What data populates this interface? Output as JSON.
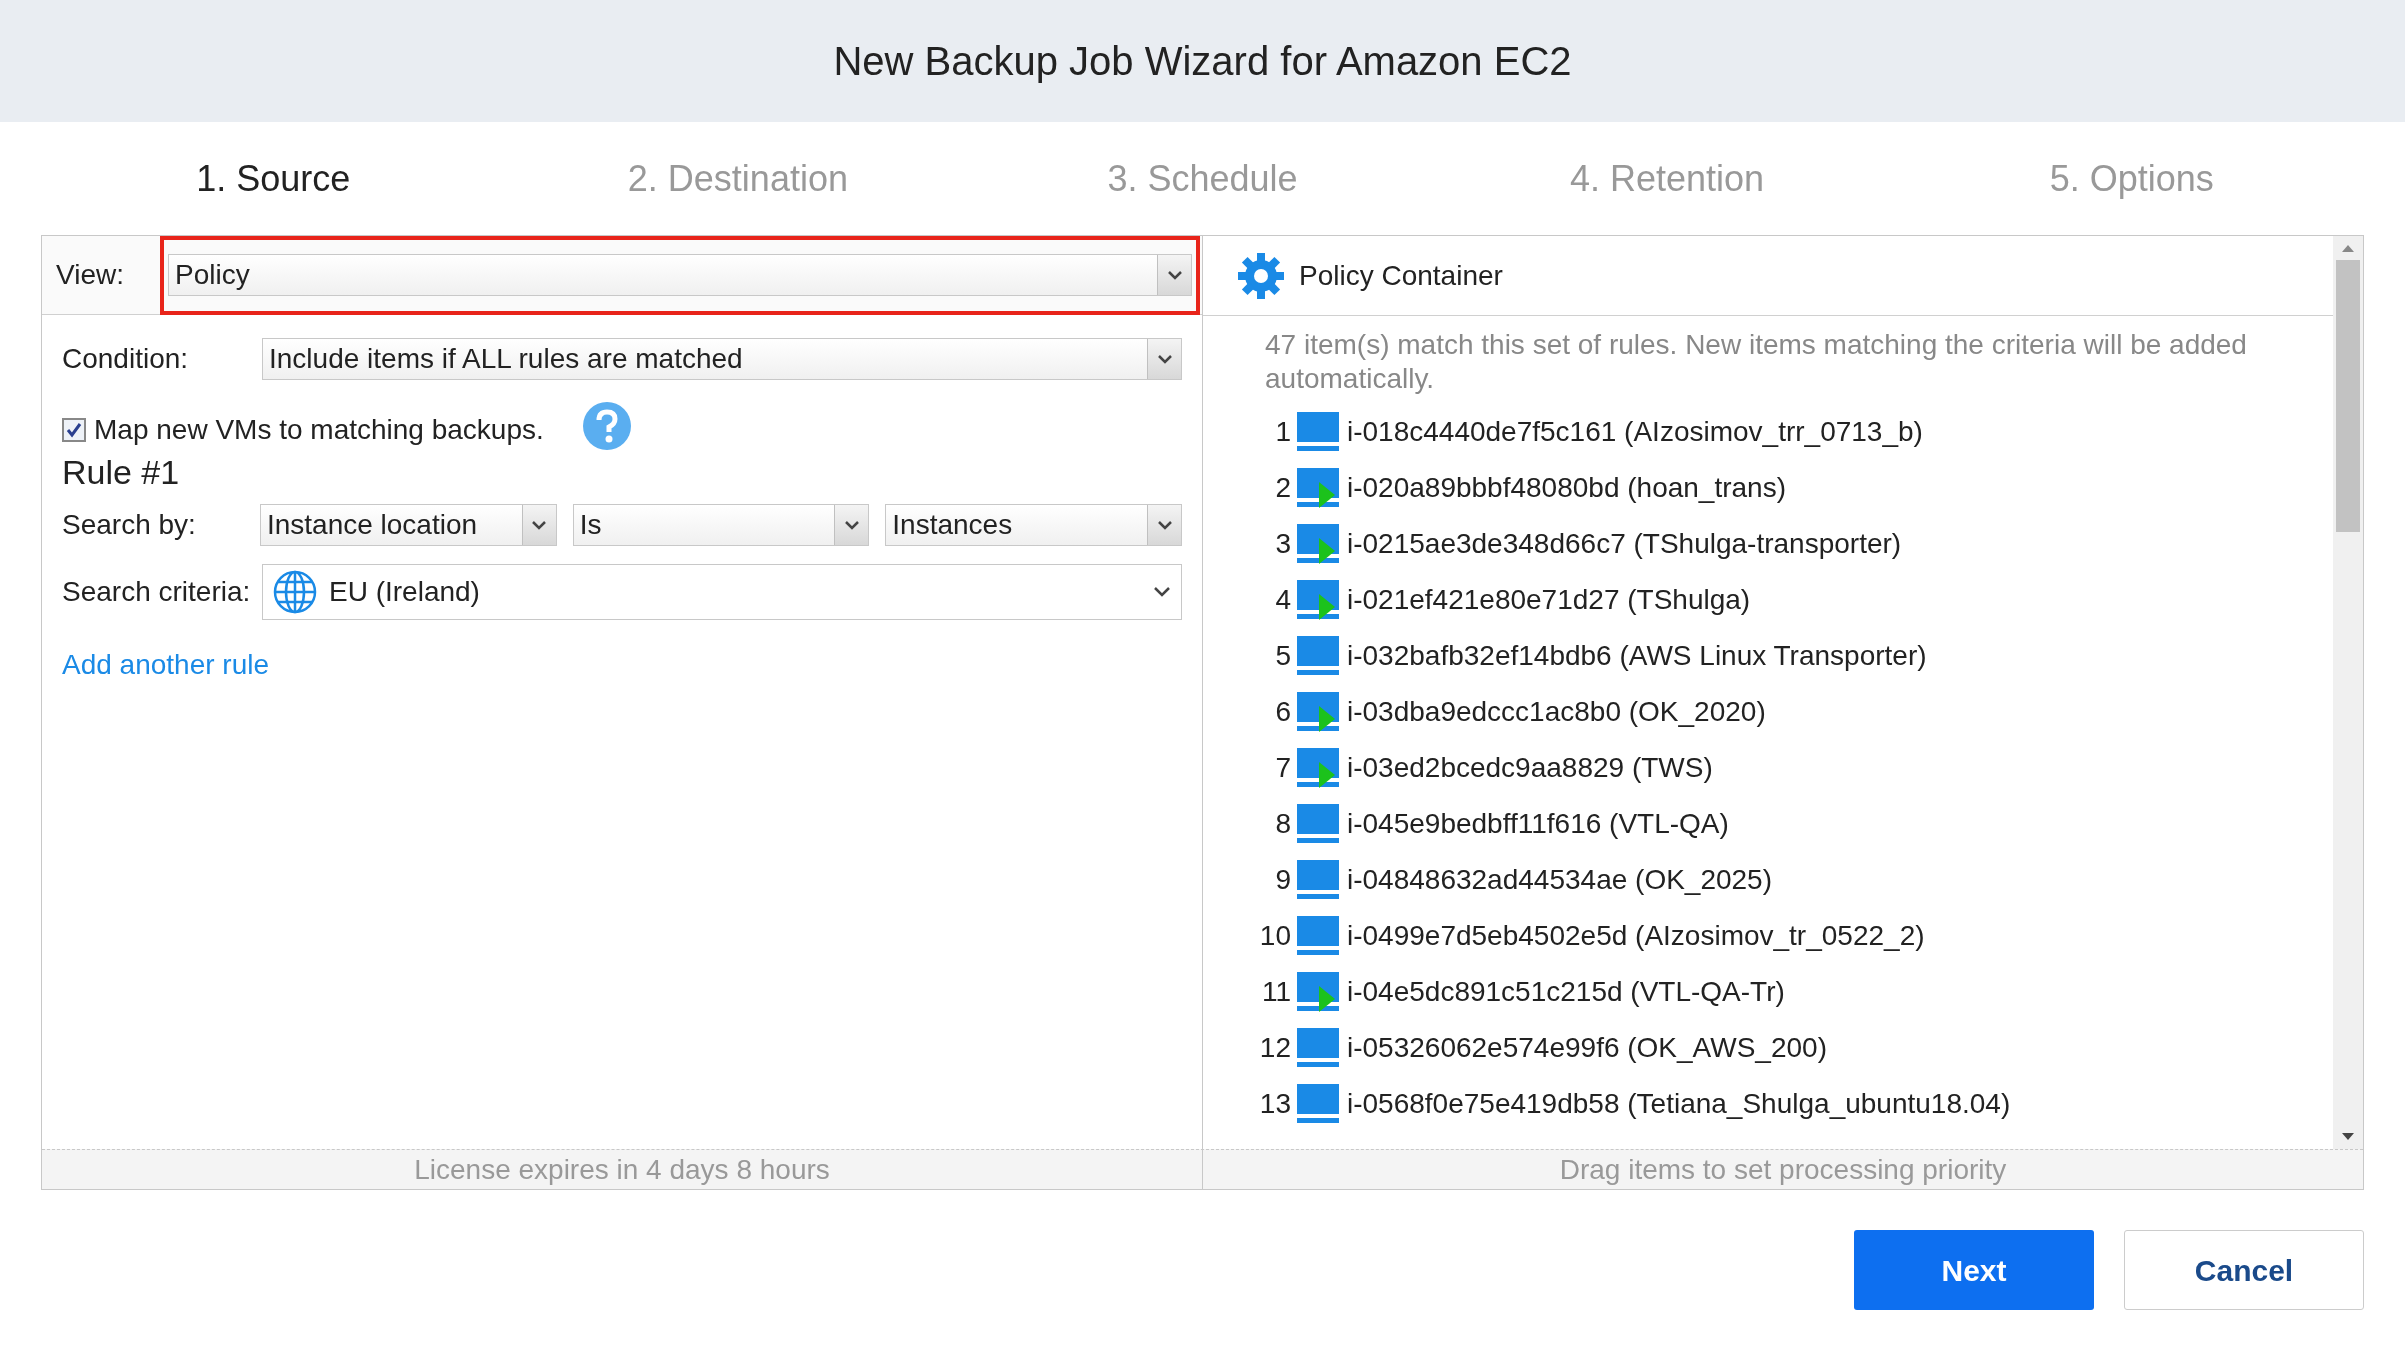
{
  "window": {
    "title": "New Backup Job Wizard for Amazon EC2"
  },
  "steps": [
    {
      "label": "1. Source",
      "selected": true
    },
    {
      "label": "2. Destination",
      "selected": false
    },
    {
      "label": "3. Schedule",
      "selected": false
    },
    {
      "label": "4. Retention",
      "selected": false
    },
    {
      "label": "5. Options",
      "selected": false
    }
  ],
  "view": {
    "label": "View:",
    "value": "Policy",
    "highlighted": true
  },
  "condition": {
    "label": "Condition:",
    "value": "Include items if ALL rules are matched"
  },
  "map_new_vms": {
    "label": "Map new VMs to matching backups.",
    "checked": true
  },
  "rule": {
    "title": "Rule #1",
    "search_by_label": "Search by:",
    "search_by": [
      "Instance location",
      "Is",
      "Instances"
    ],
    "criteria_label": "Search criteria:",
    "criteria": "EU (Ireland)"
  },
  "add_rule_link": "Add another rule",
  "left_footer": "License expires in 4 days 8 hours",
  "container": {
    "title": "Policy Container",
    "summary": "47 item(s) match this set of rules. New items matching the criteria will be added automatically.",
    "items": [
      {
        "number": "1",
        "label": "i-018c4440de7f5c161 (AIzosimov_trr_0713_b)",
        "running": false
      },
      {
        "number": "2",
        "label": "i-020a89bbbf48080bd (hoan_trans)",
        "running": true
      },
      {
        "number": "3",
        "label": "i-0215ae3de348d66c7 (TShulga-transporter)",
        "running": true
      },
      {
        "number": "4",
        "label": "i-021ef421e80e71d27 (TShulga)",
        "running": true
      },
      {
        "number": "5",
        "label": "i-032bafb32ef14bdb6 (AWS Linux Transporter)",
        "running": false
      },
      {
        "number": "6",
        "label": "i-03dba9edccc1ac8b0 (OK_2020)",
        "running": true
      },
      {
        "number": "7",
        "label": "i-03ed2bcedc9aa8829 (TWS)",
        "running": true
      },
      {
        "number": "8",
        "label": "i-045e9bedbff11f616 (VTL-QA)",
        "running": false
      },
      {
        "number": "9",
        "label": "i-04848632ad44534ae (OK_2025)",
        "running": false
      },
      {
        "number": "10",
        "label": "i-0499e7d5eb4502e5d (AIzosimov_tr_0522_2)",
        "running": false
      },
      {
        "number": "11",
        "label": "i-04e5dc891c51c215d (VTL-QA-Tr)",
        "running": true
      },
      {
        "number": "12",
        "label": "i-05326062e574e99f6 (OK_AWS_200)",
        "running": false
      },
      {
        "number": "13",
        "label": "i-0568f0e75e419db58 (Tetiana_Shulga_ubuntu18.04)",
        "running": false
      }
    ]
  },
  "right_footer": "Drag items to set processing priority",
  "buttons": {
    "next": "Next",
    "cancel": "Cancel"
  }
}
